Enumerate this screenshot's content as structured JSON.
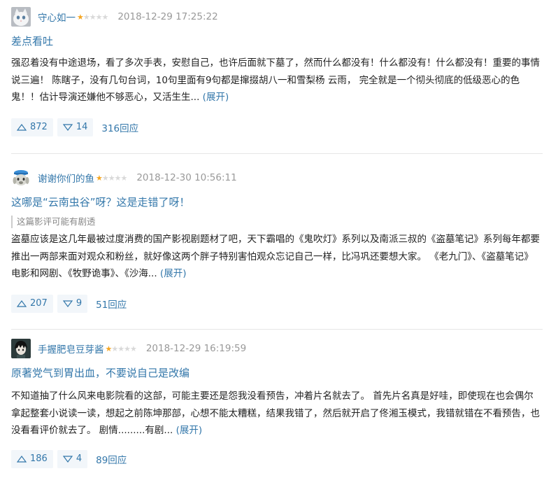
{
  "reviews": [
    {
      "author": "守心如一",
      "stars": "★",
      "stars_empty": "★★★★",
      "time": "2018-12-29 17:25:22",
      "title": "差点看吐",
      "spoiler": "",
      "body": "强忍着没有中途退场，看了多次手表，安慰自己，也许后面就下墓了，然而什么都没有！什么都没有！什么都没有！重要的事情说三遍！ 陈瞎子，没有几句台词，10句里面有9句都是撺掇胡八一和雪梨杨 云雨， 完全就是一个彻头彻底的低级恶心的色鬼！！估计导演还嫌他不够恶心，又活生生...",
      "expand": "(展开)",
      "useful": "872",
      "useless": "14",
      "replies": "316回应"
    },
    {
      "author": "谢谢你们的鱼",
      "stars": "★",
      "stars_empty": "★★★★",
      "time": "2018-12-30 10:56:11",
      "title": "这哪是“云南虫谷”呀？这是走错了呀！",
      "spoiler": "这篇影评可能有剧透",
      "body": "盗墓应该是这几年最被过度消费的国产影视剧题材了吧，天下霸唱的《鬼吹灯》系列以及南派三叔的《盗墓笔记》系列每年都要推出一两部来面对观众和粉丝，就好像这两个胖子特别害怕观众忘记自己一样，比冯巩还要想大家。 《老九门》、《盗墓笔记》电影和网剧、《牧野诡事》、《沙海...",
      "expand": "(展开)",
      "useful": "207",
      "useless": "9",
      "replies": "51回应"
    },
    {
      "author": "手握肥皂豆芽酱",
      "stars": "★",
      "stars_empty": "★★★★",
      "time": "2018-12-29 16:19:59",
      "title": "原著党气到胃出血，不要说自己是改编",
      "spoiler": "",
      "body": "不知道抽了什么风来电影院看的这部，可能主要还是怨我没看预告，冲着片名就去了。 首先片名真是好哇，即使现在也会偶尔拿起整套小说读一读，想起之前陈坤那部，心想不能太糟糕，结果我错了，然后就开启了佟湘玉模式，我错就错在不看预告，也没看看评价就去了。 剧情.........有剧...",
      "expand": "(展开)",
      "useful": "186",
      "useless": "4",
      "replies": "89回应"
    }
  ]
}
